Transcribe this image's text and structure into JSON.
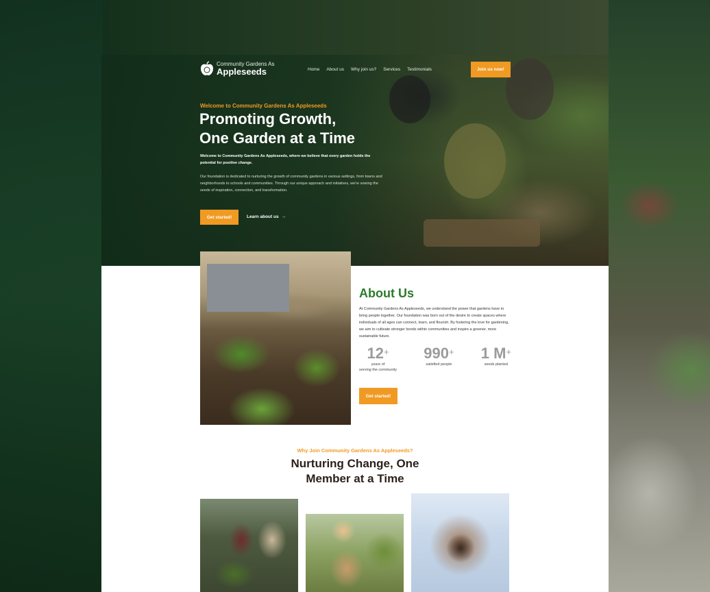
{
  "brand": {
    "small": "Community Gardens As",
    "big": "Appleseeds"
  },
  "nav": {
    "links": [
      "Home",
      "About us",
      "Why join us?",
      "Services",
      "Testimonials"
    ],
    "join_label": "Join us now!"
  },
  "hero": {
    "eyebrow": "Welcome to Community Gardens As Appleseeds",
    "title_line1": "Promoting Growth,",
    "title_line2": "One Garden at a Time",
    "lead": "Welcome to Community Gardens As Appleseeds, where we believe that every garden holds the potential for positive change.",
    "body": "Our foundation is dedicated to nurturing the growth of community gardens in various settings, from towns and neighborhoods to schools and communities. Through our unique approach and initiatives, we're sowing the seeds of inspiration, connection, and transformation.",
    "cta_label": "Get started!",
    "learn_label": "Learn about us",
    "learn_arrow": "→"
  },
  "about": {
    "title": "About Us",
    "body": "At Community Gardens As Appleseeds, we understand the power that gardens have to bring people together. Our foundation was born out of the desire to create spaces where individuals of all ages can connect, learn, and flourish. By fostering the love for gardening, we aim to cultivate stronger bonds within communities and inspire a greener, more sustainable future.",
    "stats": [
      {
        "value": "12",
        "suffix": "+",
        "label_line1": "years of",
        "label_line2": "serving the community"
      },
      {
        "value": "990",
        "suffix": "+",
        "label_line1": "satisfied people",
        "label_line2": ""
      },
      {
        "value": "1 M",
        "suffix": "+",
        "label_line1": "seeds planted",
        "label_line2": ""
      }
    ],
    "cta_label": "Get started!"
  },
  "why": {
    "eyebrow": "Why Join Community Gardens As Appleseeds?",
    "title_line1": "Nurturing Change, One",
    "title_line2": "Member at a Time"
  },
  "colors": {
    "accent": "#f19a23",
    "brand_green": "#2c7a2c",
    "hero_bg": "#14301c"
  }
}
